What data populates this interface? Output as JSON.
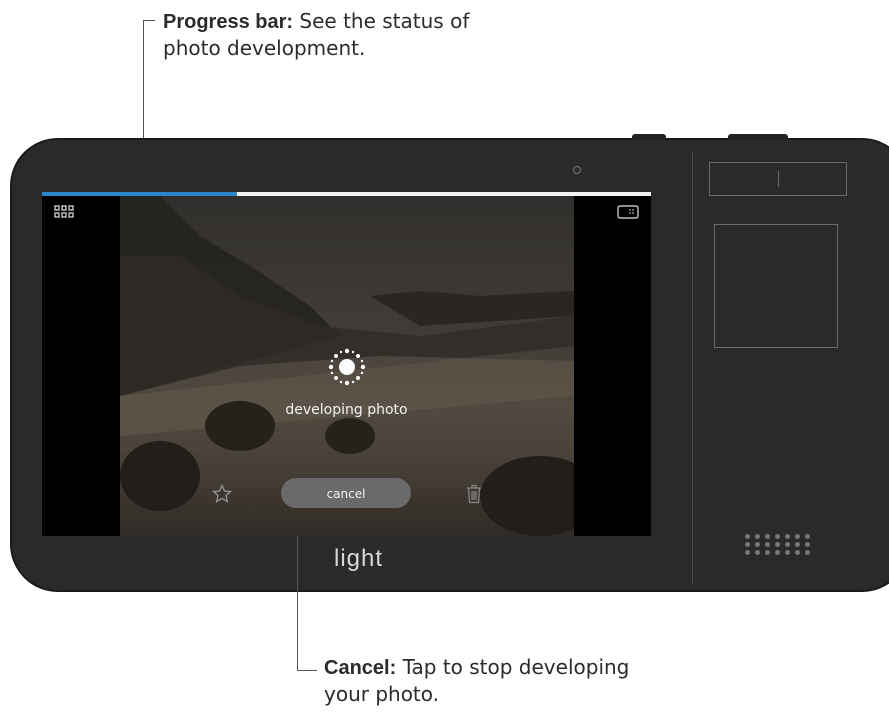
{
  "callouts": {
    "progress": {
      "title": "Progress bar:",
      "text": "See the status of photo development."
    },
    "cancel": {
      "title": "Cancel:",
      "text": "Tap to stop developing your photo."
    }
  },
  "screen": {
    "progress_fraction": 0.32,
    "progress_color": "#2a86c8",
    "status_label": "developing photo",
    "cancel_label": "cancel",
    "icons": {
      "top_left": "gallery-grid-icon",
      "top_right": "aspect-ratio-icon",
      "center": "processing-spinner-icon",
      "bottom_left": "favorite-star-icon",
      "bottom_right": "trash-icon"
    }
  },
  "device": {
    "logo": "light"
  }
}
